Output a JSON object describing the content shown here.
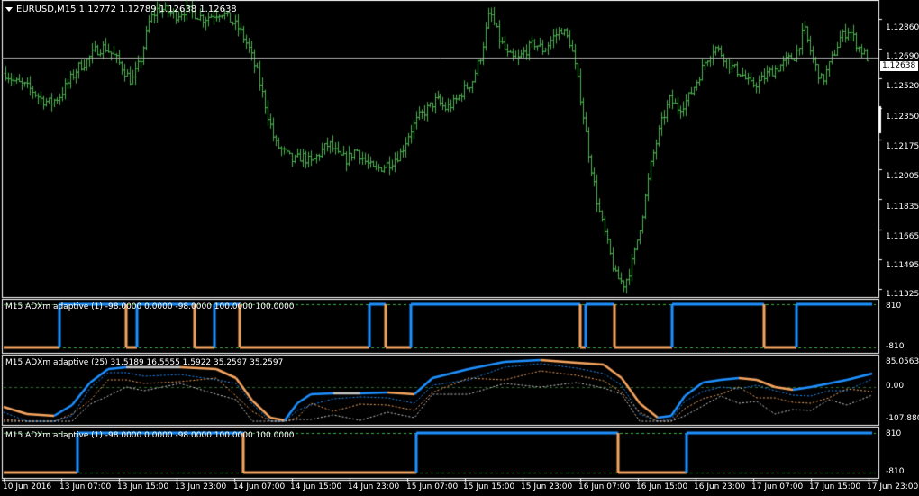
{
  "main_chart": {
    "symbol_label": "EURUSD,M15",
    "ohlc": [
      "1.12772",
      "1.12789",
      "1.12638",
      "1.12638"
    ],
    "current_price": "1.12638",
    "price_axis": [
      "1.12860",
      "1.12690",
      "1.12520",
      "1.12350",
      "1.12175",
      "1.12005",
      "1.11835",
      "1.11665",
      "1.11495",
      "1.11325"
    ],
    "bar_color": "#4caf50",
    "line_color": "#b0b0b0"
  },
  "indicators": [
    {
      "title": "M15 ADXm adaptive (1) -98.0000 0.0000 -98.0000 100.0000 100.0000",
      "axis_top": "810",
      "axis_bottom": "-810",
      "up_color": "#1e90ff",
      "down_color": "#f4a460"
    },
    {
      "title": "M15 ADXm adaptive (25) 31.5189 16.5555 1.5922 35.2597 35.2597",
      "axis_top": "85.0563",
      "axis_mid": "0.00",
      "axis_bottom": "-107.8803",
      "up_color": "#1e90ff",
      "down_color": "#f4a460"
    },
    {
      "title": "M15 ADXm adaptive (1) -98.0000 0.0000 -98.0000 100.0000 100.0000",
      "axis_top": "810",
      "axis_bottom": "-810",
      "up_color": "#1e90ff",
      "down_color": "#f4a460"
    }
  ],
  "time_axis": [
    "10 Jun 2016",
    "13 Jun 07:00",
    "13 Jun 15:00",
    "13 Jun 23:00",
    "14 Jun 07:00",
    "14 Jun 15:00",
    "14 Jun 23:00",
    "15 Jun 07:00",
    "15 Jun 15:00",
    "15 Jun 23:00",
    "16 Jun 07:00",
    "16 Jun 15:00",
    "16 Jun 23:00",
    "17 Jun 07:00",
    "17 Jun 15:00",
    "17 Jun 23:00"
  ],
  "chart_data": {
    "type": "line",
    "series": [
      {
        "values": [
          1.1255,
          1.125,
          1.1248,
          1.1245,
          1.124,
          1.1238,
          1.1242,
          1.125,
          1.1258,
          1.1262,
          1.1268,
          1.127,
          1.1265,
          1.1258,
          1.125,
          1.1262,
          1.1285,
          1.1292,
          1.129,
          1.1288,
          1.1291,
          1.1289,
          1.1286,
          1.1288,
          1.129,
          1.1285,
          1.128,
          1.127,
          1.1255,
          1.1235,
          1.1215,
          1.121,
          1.1205,
          1.1208,
          1.1204,
          1.121,
          1.1215,
          1.1208,
          1.1206,
          1.1212,
          1.1205,
          1.12,
          1.1202,
          1.1205,
          1.121,
          1.1222,
          1.123,
          1.1235,
          1.124,
          1.1235,
          1.1238,
          1.1245,
          1.125,
          1.1265,
          1.129,
          1.1275,
          1.1265,
          1.1262,
          1.1268,
          1.1272,
          1.1268,
          1.1275,
          1.128,
          1.1272,
          1.1245,
          1.121,
          1.118,
          1.116,
          1.114,
          1.1135,
          1.115,
          1.1175,
          1.1205,
          1.1225,
          1.124,
          1.1235,
          1.124,
          1.125,
          1.1262,
          1.127,
          1.1265,
          1.1258,
          1.1255,
          1.1248,
          1.125,
          1.1255,
          1.1258,
          1.1262,
          1.1265,
          1.128,
          1.1262,
          1.125,
          1.1262,
          1.1275,
          1.128,
          1.127,
          1.1264
        ]
      }
    ]
  }
}
